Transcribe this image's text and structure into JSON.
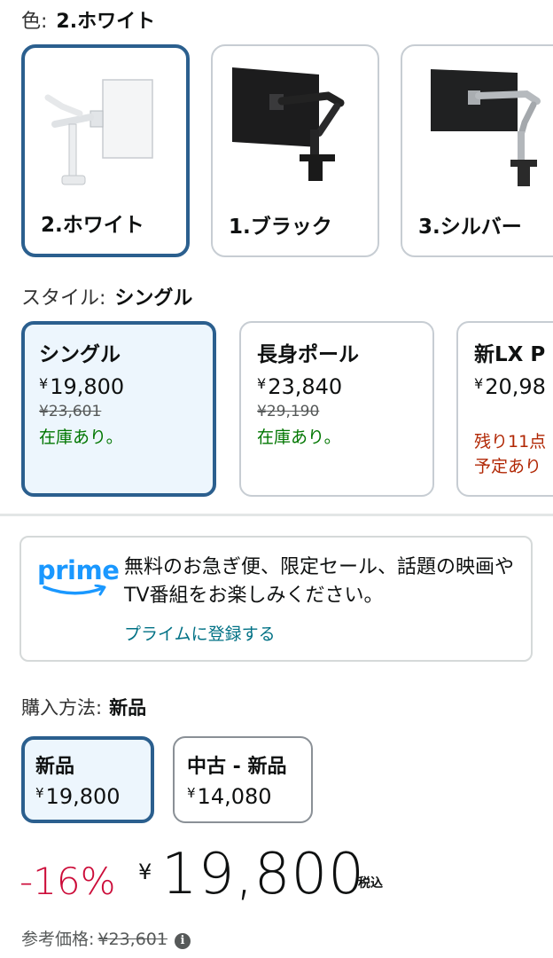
{
  "color": {
    "label": "色:",
    "selected": "2.ホワイト",
    "options": [
      {
        "name": "2.ホワイト"
      },
      {
        "name": "1.ブラック"
      },
      {
        "name": "3.シルバー"
      }
    ]
  },
  "style": {
    "label": "スタイル:",
    "selected": "シングル",
    "options": [
      {
        "name": "シングル",
        "yen": "¥",
        "price": "19,800",
        "list_price": "¥23,601",
        "stock": "在庫あり。"
      },
      {
        "name": "長身ポール",
        "yen": "¥",
        "price": "23,840",
        "list_price": "¥29,190",
        "stock": "在庫あり。"
      },
      {
        "name": "新LX P",
        "yen": "¥",
        "price": "20,98",
        "stock_line1": "残り11点",
        "stock_line2": "予定あり"
      }
    ]
  },
  "prime": {
    "logo_text": "prime",
    "message": "無料のお急ぎ便、限定セール、話題の映画やTV番組をお楽しみください。",
    "link": "プライムに登録する"
  },
  "purchase": {
    "label": "購入方法:",
    "selected": "新品",
    "options": [
      {
        "name": "新品",
        "yen": "¥",
        "price": "19,800"
      },
      {
        "name": "中古 - 新品",
        "yen": "¥",
        "price": "14,080"
      }
    ]
  },
  "price": {
    "discount": "-16%",
    "yen": "¥",
    "amount": "19,800",
    "tax": "税込",
    "reference_label": "参考価格:",
    "reference_price": "¥23,601"
  },
  "colors": {
    "selected_border": "#2b5f8e",
    "selected_bg": "#edf6fd",
    "in_stock": "#007600",
    "low_stock": "#b12704",
    "discount": "#cc0c39",
    "link": "#007185",
    "prime_blue": "#1a98ff"
  }
}
